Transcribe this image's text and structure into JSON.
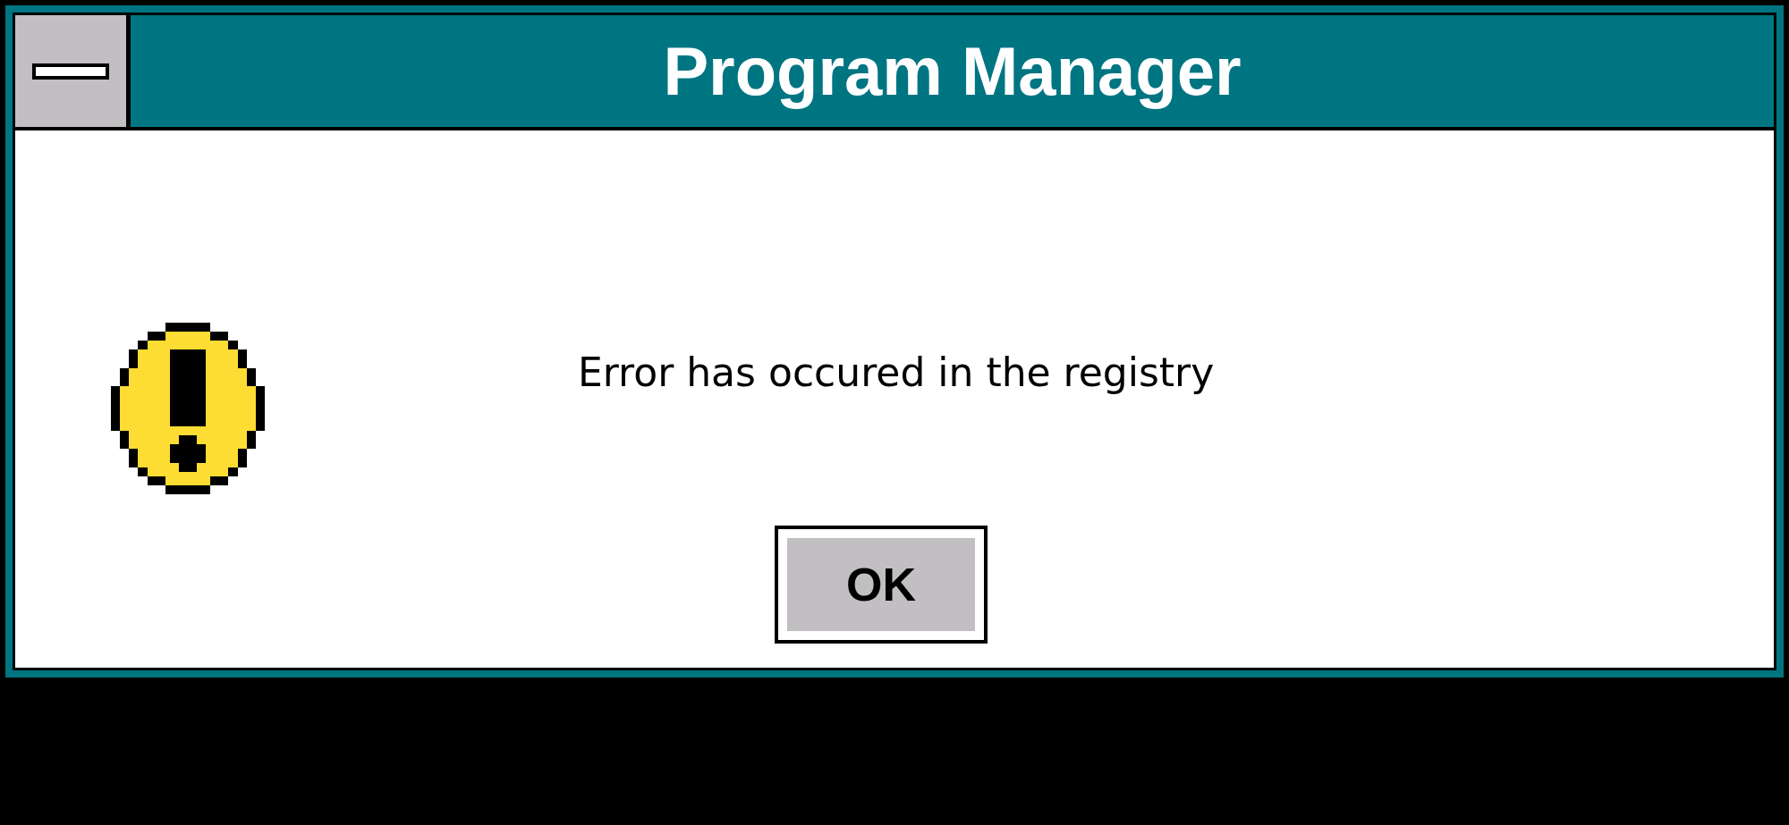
{
  "window": {
    "title": "Program Manager"
  },
  "message": "Error has occured in the registry",
  "buttons": [
    "OK"
  ]
}
